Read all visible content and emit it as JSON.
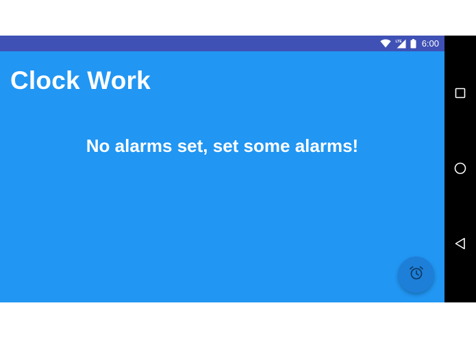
{
  "status_bar": {
    "time": "6:00",
    "network_label": "LTE",
    "icons": [
      "wifi-icon",
      "lte-signal-icon",
      "battery-icon"
    ]
  },
  "app": {
    "title": "Clock Work",
    "empty_message": "No alarms set, set some alarms!"
  },
  "fab": {
    "icon": "alarm-icon"
  },
  "nav_bar": {
    "buttons": [
      "recents-icon",
      "home-icon",
      "back-icon"
    ]
  },
  "colors": {
    "status_bar": "#3f51b5",
    "background": "#2196f3",
    "fab": "#1e7fd8",
    "nav_bar": "#000000",
    "text": "#ffffff"
  }
}
